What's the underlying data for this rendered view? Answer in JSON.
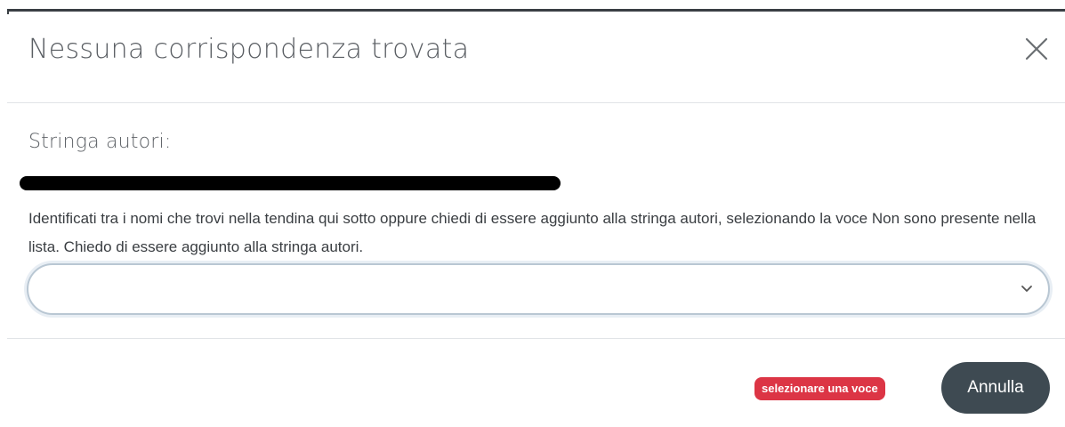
{
  "modal": {
    "title": "Nessuna corrispondenza trovata",
    "close_icon": "close-icon"
  },
  "body": {
    "label": "Stringa autori:",
    "help_text": "Identificati tra i nomi che trovi nella tendina qui sotto oppure chiedi di essere aggiunto alla stringa autori, selezionando la voce Non sono presente nella lista. Chiedo di essere aggiunto alla stringa autori.",
    "select": {
      "value": "",
      "icon": "chevron-down-icon"
    }
  },
  "footer": {
    "error_badge": "selezionare una voce",
    "cancel_label": "Annulla"
  },
  "colors": {
    "error": "#dc3545",
    "cancel_button": "#3e4a52",
    "select_border": "#b9c7d3"
  }
}
